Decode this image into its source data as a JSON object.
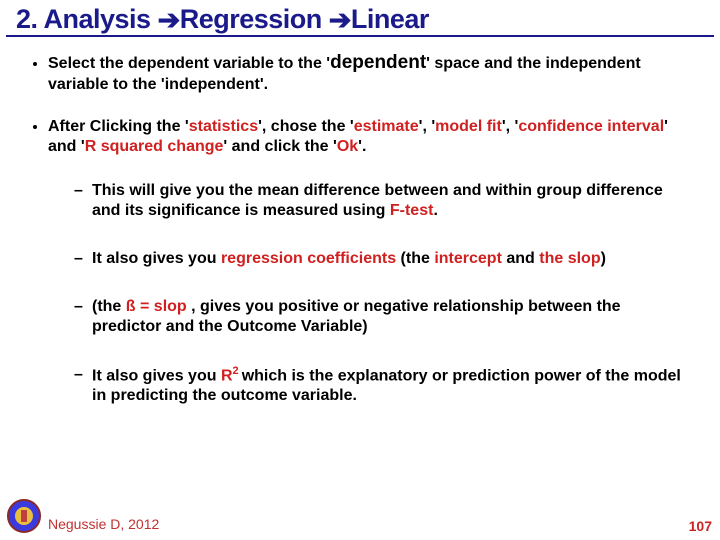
{
  "title": {
    "prefix": "2. Analysis ",
    "mid": "Regression ",
    "last": "Linear"
  },
  "bullets": {
    "b1": {
      "t1": "Select the dependent variable to the '",
      "dep": "dependent",
      "t2": "' space and the independent variable to the 'independent'."
    },
    "b2": {
      "t1": "After Clicking the '",
      "stats": "statistics",
      "t2": "', chose the '",
      "est": "estimate",
      "t3": "', '",
      "mf": "model fit",
      "t4": "', '",
      "ci": "confidence interval",
      "t5": "' and '",
      "rsc": "R squared change",
      "t6": "' and click the '",
      "ok": "Ok",
      "t7": "'."
    },
    "s1": {
      "t1": "This will give you the mean difference between and within group difference and its significance is measured using ",
      "ft": "F-test",
      "t2": "."
    },
    "s2": {
      "t1": "It also gives you ",
      "rc": "regression coefficients",
      "t2": " (the ",
      "ic": "intercept",
      "t3": " and ",
      "sl": "the slop",
      "t4": ")"
    },
    "s3": {
      "t1": "(the ",
      "bs": "ß = slop ",
      "t2": " , gives you positive or negative relationship between the predictor and the Outcome Variable)"
    },
    "s4": {
      "t1": "It also gives you ",
      "r": "R",
      "sup": "2 ",
      "t2": "which is the explanatory or prediction power of the model in predicting the outcome variable."
    }
  },
  "footer": "Negussie D, 2012",
  "page": "107"
}
